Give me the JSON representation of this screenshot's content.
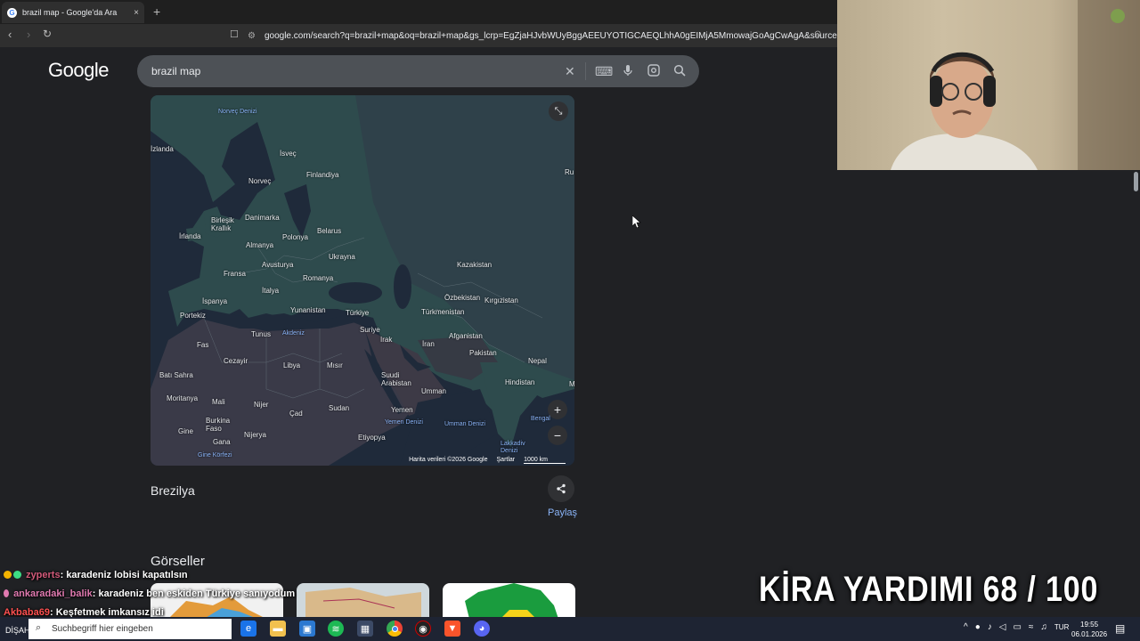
{
  "browser": {
    "tab_title": "brazil map - Google'da Ara",
    "tab_close": "×",
    "new_tab": "+",
    "url": "google.com/search?q=brazil+map&oq=brazil+map&gs_lcrp=EgZjaHJvbWUyBggAEEUYOTIGCAEQLhhA0gEIMjA5MmowajGoAgCwAgA&sourcei..."
  },
  "google": {
    "logo": "Google",
    "search_value": "brazil map",
    "clear_label": "✕",
    "keyboard_icon": "⌨",
    "mic_icon": "🎤",
    "lens_icon": "◉",
    "search_icon": "⌕"
  },
  "map": {
    "labels": [
      {
        "text": "Norveç Denizi",
        "sea": true
      },
      {
        "text": "İsveç"
      },
      {
        "text": "Finlandiya"
      },
      {
        "text": "Norveç"
      },
      {
        "text": "Birleşik Krallık"
      },
      {
        "text": "Danimarka"
      },
      {
        "text": "Belarus"
      },
      {
        "text": "İrlanda"
      },
      {
        "text": "Almanya"
      },
      {
        "text": "Polonya"
      },
      {
        "text": "Ukrayna"
      },
      {
        "text": "Kazakistan"
      },
      {
        "text": "Fransa"
      },
      {
        "text": "Avusturya"
      },
      {
        "text": "Romanya"
      },
      {
        "text": "İtalya"
      },
      {
        "text": "Özbekistan"
      },
      {
        "text": "Kırgızistan"
      },
      {
        "text": "İspanya"
      },
      {
        "text": "Yunanistan"
      },
      {
        "text": "Türkiye"
      },
      {
        "text": "Türkmenistan"
      },
      {
        "text": "Portekiz"
      },
      {
        "text": "Tunus"
      },
      {
        "text": "Akdeniz",
        "sea": true
      },
      {
        "text": "Suriye"
      },
      {
        "text": "Irak"
      },
      {
        "text": "İran"
      },
      {
        "text": "Afganistan"
      },
      {
        "text": "Fas"
      },
      {
        "text": "Cezayir"
      },
      {
        "text": "Libya"
      },
      {
        "text": "Mısır"
      },
      {
        "text": "Pakistan"
      },
      {
        "text": "Nepal"
      },
      {
        "text": "Batı Sahra"
      },
      {
        "text": "Suudi Arabistan"
      },
      {
        "text": "Umman"
      },
      {
        "text": "Hindistan"
      },
      {
        "text": "Moritanya"
      },
      {
        "text": "Mali"
      },
      {
        "text": "Nijer"
      },
      {
        "text": "Çad"
      },
      {
        "text": "Sudan"
      },
      {
        "text": "Yemen"
      },
      {
        "text": "Burkina Faso"
      },
      {
        "text": "Yemen Denizi",
        "sea": true
      },
      {
        "text": "Umman Denizi",
        "sea": true
      },
      {
        "text": "Bengal",
        "sea": true
      },
      {
        "text": "Gine"
      },
      {
        "text": "Nijerya"
      },
      {
        "text": "Etiyopya"
      },
      {
        "text": "Gana"
      },
      {
        "text": "Lakkadiv Denizi",
        "sea": true
      },
      {
        "text": "Gine Körfezi",
        "sea": true
      },
      {
        "text": "İzlanda"
      },
      {
        "text": "Ru"
      },
      {
        "text": "M"
      }
    ],
    "attribution": "Harita verileri ©2026 Google",
    "terms": "Şartlar",
    "scale": "1000 km",
    "zoom_in": "+",
    "zoom_out": "−",
    "collapse_icon": "⤡"
  },
  "place": {
    "name": "Brezilya",
    "share_label": "Paylaş",
    "share_icon": "⇪"
  },
  "images_heading": "Görseller",
  "chat": [
    {
      "user": "zyperts",
      "message": ": karadeniz lobisi kapatılsın"
    },
    {
      "user": "ankaradaki_balik",
      "message": ": karadeniz ben eskiden Türkiye sanıyodum"
    },
    {
      "user": "Akbaba69",
      "message": ": Keşfetmek imkansız idi"
    }
  ],
  "overlay": {
    "kira": "KİRA YARDIMI  68 / 100"
  },
  "taskbar": {
    "search_placeholder": "Suchbegriff hier eingeben",
    "partial_text": "DİŞAH DİS",
    "lang": "TUR",
    "time": "19:55",
    "date": "06.01.2026"
  },
  "colors": {
    "page_bg": "#202124",
    "link": "#8ab4f8",
    "taskbar": "#1e2433"
  }
}
